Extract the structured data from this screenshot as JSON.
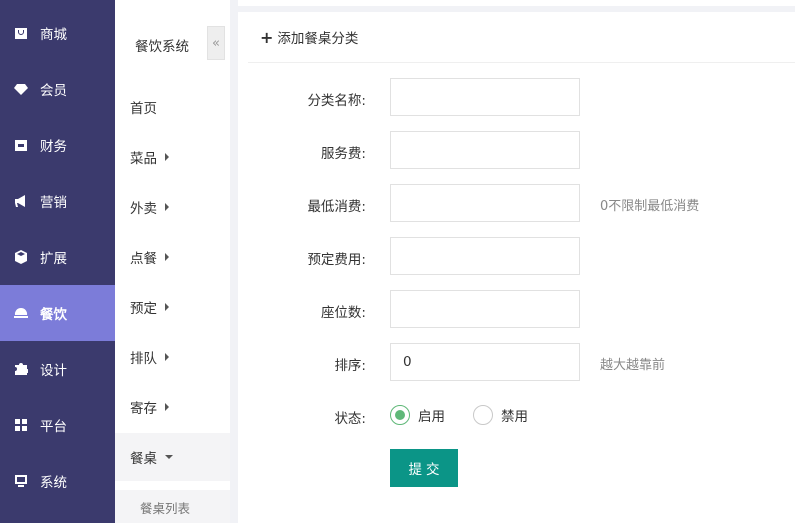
{
  "rail": {
    "items": [
      {
        "label": "商城",
        "icon": "bag-icon"
      },
      {
        "label": "会员",
        "icon": "diamond-icon"
      },
      {
        "label": "财务",
        "icon": "wallet-icon"
      },
      {
        "label": "营销",
        "icon": "megaphone-icon"
      },
      {
        "label": "扩展",
        "icon": "cube-icon"
      },
      {
        "label": "餐饮",
        "icon": "dish-icon",
        "active": true
      },
      {
        "label": "设计",
        "icon": "puzzle-icon"
      },
      {
        "label": "平台",
        "icon": "grid-icon"
      },
      {
        "label": "系统",
        "icon": "monitor-icon"
      }
    ],
    "active_color": "#7c7cd9",
    "bg_color": "#3b3a6d"
  },
  "subnav": {
    "title": "餐饮系统",
    "collapse_glyph": "«",
    "items": [
      {
        "label": "首页"
      },
      {
        "label": "菜品"
      },
      {
        "label": "外卖"
      },
      {
        "label": "点餐"
      },
      {
        "label": "预定"
      },
      {
        "label": "排队"
      },
      {
        "label": "寄存"
      },
      {
        "label": "餐桌"
      }
    ],
    "sub_item": "餐桌列表"
  },
  "panel": {
    "title": "添加餐桌分类",
    "plus_glyph": "+"
  },
  "form": {
    "name_label": "分类名称:",
    "service_fee_label": "服务费:",
    "min_spend_label": "最低消费:",
    "min_spend_hint": "0不限制最低消费",
    "reserve_fee_label": "预定费用:",
    "seats_label": "座位数:",
    "sort_label": "排序:",
    "sort_value": "0",
    "sort_hint": "越大越靠前",
    "status_label": "状态:",
    "status_enabled": "启用",
    "status_disabled": "禁用",
    "status_selected": "启用",
    "submit_label": "提交",
    "accent_color": "#0b9587"
  }
}
